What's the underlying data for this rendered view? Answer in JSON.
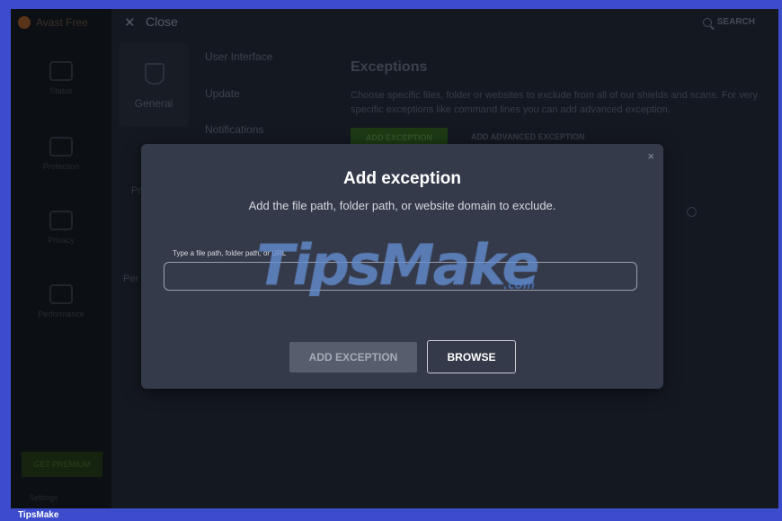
{
  "app": {
    "brand": "Avast Free",
    "close_label": "Close",
    "search_label": "SEARCH"
  },
  "nav": {
    "items": [
      "Status",
      "Protection",
      "Privacy",
      "Performance"
    ],
    "green_button": "GET PREMIUM",
    "footer": "Settings"
  },
  "settings": {
    "category": "General",
    "submenu": [
      "User Interface",
      "Update",
      "Notifications"
    ],
    "section_title": "Exceptions",
    "section_desc": "Choose specific files, folder or websites to exclude from all of our shields and scans. For very specific exceptions like command lines you can add advanced exception.",
    "add_exception_bg": "ADD EXCEPTION",
    "add_advanced": "ADD ADVANCED EXCEPTION",
    "bg_label_1": "Pr",
    "bg_label_2": "Per"
  },
  "modal": {
    "close": "×",
    "title": "Add exception",
    "subtitle": "Add the file path, folder path, or website domain to exclude.",
    "field_label": "Type a file path, folder path, or URL",
    "field_value": "",
    "add_button": "ADD EXCEPTION",
    "browse_button": "BROWSE"
  },
  "watermark": {
    "text": "TipsMake",
    "domain": ".com"
  },
  "footer_brand": "TipsMake",
  "colors": {
    "modal_bg": "#343a4a",
    "frame": "#3c4ccc",
    "accent_green": "#1d3a14"
  }
}
